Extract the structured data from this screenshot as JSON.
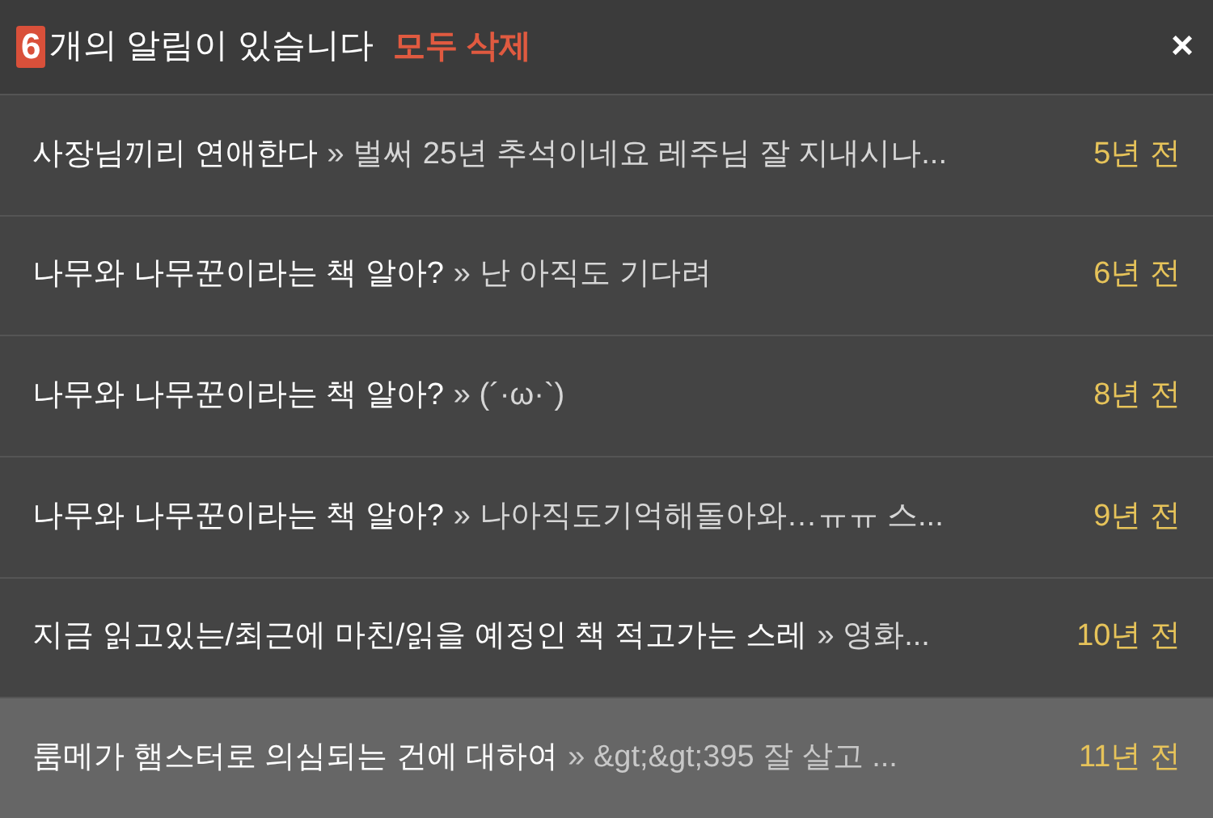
{
  "header": {
    "count": "6",
    "title": "개의 알림이 있습니다",
    "delete_all": "모두 삭제",
    "close": "×"
  },
  "notifications": [
    {
      "title": "사장님끼리 연애한다",
      "snippet": "» 벌써 25년 추석이네요 레주님 잘 지내시나...",
      "time": "5년 전",
      "selected": false
    },
    {
      "title": "나무와 나무꾼이라는 책 알아?",
      "snippet": "» 난 아직도 기다려",
      "time": "6년 전",
      "selected": false
    },
    {
      "title": "나무와 나무꾼이라는 책 알아?",
      "snippet": "» (´·ω·`)",
      "time": "8년 전",
      "selected": false
    },
    {
      "title": "나무와 나무꾼이라는 책 알아?",
      "snippet": "» 나아직도기억해돌아와…ㅠㅠ 스...",
      "time": "9년 전",
      "selected": false
    },
    {
      "title": "지금 읽고있는/최근에 마친/읽을 예정인 책 적고가는 스레",
      "snippet": "» 영화...",
      "time": "10년 전",
      "selected": false
    },
    {
      "title": "룸메가 햄스터로 의심되는 건에 대하여",
      "snippet": "» &gt;&gt;395 잘 살고 ...",
      "time": "11년 전",
      "selected": true
    }
  ]
}
